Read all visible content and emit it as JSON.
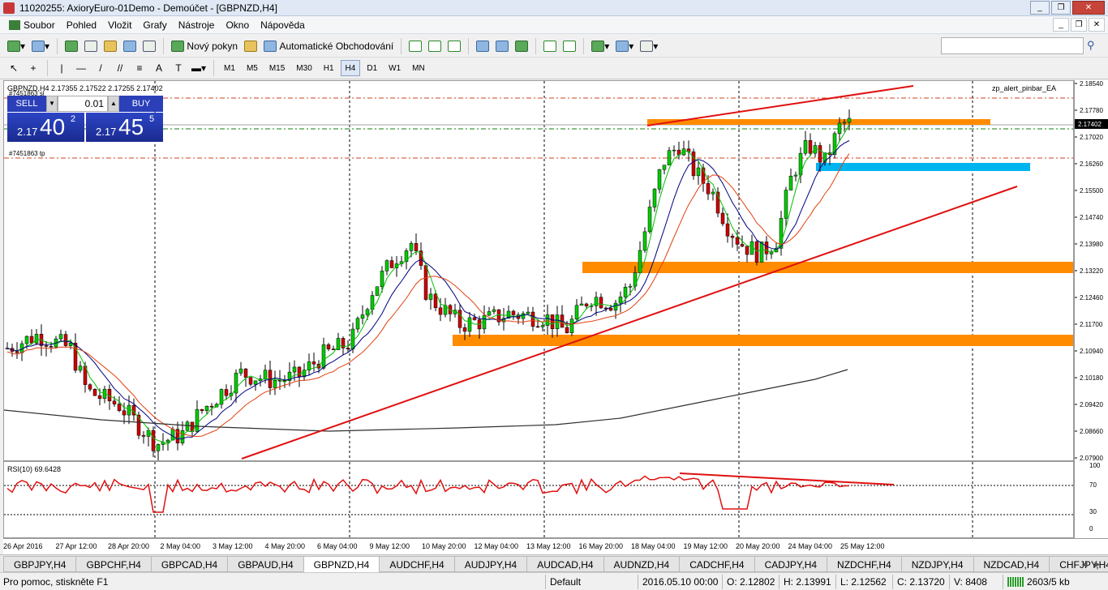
{
  "window": {
    "title": "11020255: AxioryEuro-01Demo - Demoúčet - [GBPNZD,H4]",
    "controls": [
      "_",
      "❐",
      "✕"
    ]
  },
  "menu": {
    "items": [
      "Soubor",
      "Pohled",
      "Vložit",
      "Grafy",
      "Nástroje",
      "Okno",
      "Nápověda"
    ],
    "mdi_controls": [
      "_",
      "❐",
      "✕"
    ]
  },
  "toolbar": {
    "new_order": "Nový pokyn",
    "auto_trading": "Automatické Obchodování"
  },
  "timeframes": {
    "items": [
      "M1",
      "M5",
      "M15",
      "M30",
      "H1",
      "H4",
      "D1",
      "W1",
      "MN"
    ],
    "active": "H4"
  },
  "chart": {
    "header": "GBPNZD,H4  2.17355 2.17522 2.17255 2.17402",
    "ea_name": "zp_alert_pinbar_EA",
    "order_label_1": "#7451863 sl",
    "order_label_2": "#7451863 tp",
    "current_price": "2.17402",
    "price_ticks": [
      "2.18540",
      "2.17780",
      "2.17020",
      "2.16260",
      "2.15500",
      "2.14740",
      "2.13980",
      "2.13220",
      "2.12460",
      "2.11700",
      "2.10940",
      "2.10180",
      "2.09420",
      "2.08660",
      "2.07900"
    ],
    "time_ticks": [
      "26 Apr 2016",
      "27 Apr 12:00",
      "28 Apr 20:00",
      "2 May 04:00",
      "3 May 12:00",
      "4 May 20:00",
      "6 May 04:00",
      "9 May 12:00",
      "10 May 20:00",
      "12 May 04:00",
      "13 May 12:00",
      "16 May 20:00",
      "18 May 04:00",
      "19 May 12:00",
      "20 May 20:00",
      "24 May 04:00",
      "25 May 12:00"
    ],
    "colors": {
      "bull": "#00cc00",
      "bear": "#cc0000",
      "trend": "#e01010",
      "zone_orange": "#ff8c00",
      "zone_blue": "#00b4f0",
      "ma_fast": "#00c000",
      "ma_mid": "#000080",
      "ma_slow": "#e04010",
      "ma_long": "#303030"
    }
  },
  "trade_panel": {
    "sell_label": "SELL",
    "buy_label": "BUY",
    "lot": "0.01",
    "sell_small": "2.17",
    "sell_big": "40",
    "sell_sup": "2",
    "buy_small": "2.17",
    "buy_big": "45",
    "buy_sup": "5"
  },
  "rsi": {
    "label": "RSI(10) 69.6428",
    "ticks": [
      "100",
      "70",
      "30",
      "0"
    ]
  },
  "tabs": {
    "items": [
      "GBPJPY,H4",
      "GBPCHF,H4",
      "GBPCAD,H4",
      "GBPAUD,H4",
      "GBPNZD,H4",
      "AUDCHF,H4",
      "AUDJPY,H4",
      "AUDCAD,H4",
      "AUDNZD,H4",
      "CADCHF,H4",
      "CADJPY,H4",
      "NZDCHF,H4",
      "NZDJPY,H4",
      "NZDCAD,H4",
      "CHFJPY,H4"
    ],
    "active": "GBPNZD,H4"
  },
  "status": {
    "help": "Pro pomoc, stiskněte F1",
    "profile": "Default",
    "datetime": "2016.05.10 00:00",
    "open": "O: 2.12802",
    "high": "H: 2.13991",
    "low": "L: 2.12562",
    "close": "C: 2.13720",
    "volume": "V: 8408",
    "traffic": "2603/5 kb"
  }
}
